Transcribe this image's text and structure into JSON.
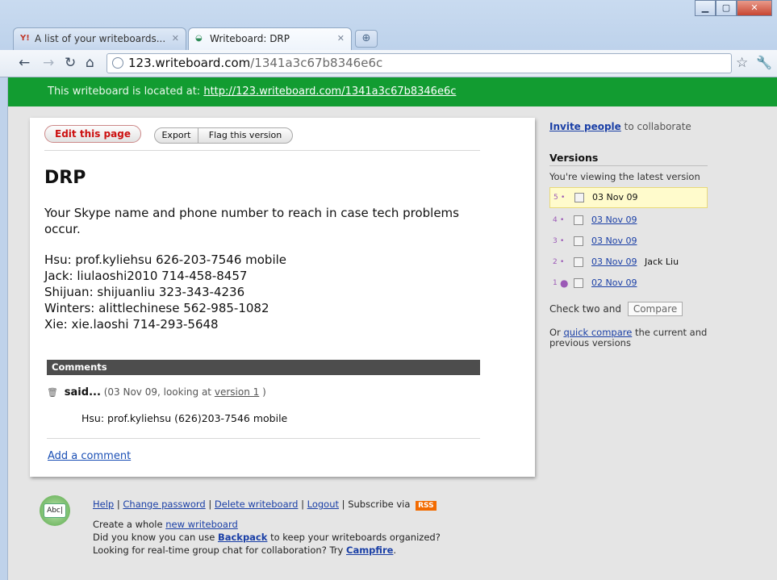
{
  "browser": {
    "tabs": [
      {
        "label": "A list of your writeboards...",
        "icon": "yahoo-icon"
      },
      {
        "label": "Writeboard: DRP",
        "icon": "writeboard-icon"
      }
    ],
    "address": {
      "host": "123.writeboard.com",
      "path": "/1341a3c67b8346e6c"
    }
  },
  "banner": {
    "text": "This writeboard is located at:",
    "link": "http://123.writeboard.com/1341a3c67b8346e6c"
  },
  "toolbar": {
    "edit_label": "Edit this page",
    "export_label": "Export",
    "flag_label": "Flag this version"
  },
  "document": {
    "title": "DRP",
    "intro": "Your Skype name and phone number to reach in case tech problems occur.",
    "contacts": [
      "Hsu: prof.kyliehsu 626-203-7546 mobile",
      "Jack: liulaoshi2010 714-458-8457",
      "Shijuan: shijuanliu 323-343-4236",
      "Winters: alittlechinese 562-985-1082",
      "Xie: xie.laoshi 714-293-5648"
    ]
  },
  "comments": {
    "header": "Comments",
    "said": "said...",
    "meta_prefix": "(03 Nov 09, looking at",
    "version_link": "version 1",
    "meta_suffix": ")",
    "text": "Hsu: prof.kyliehsu (626)203-7546 mobile",
    "add_label": "Add a comment"
  },
  "sidebar": {
    "invite_link": "Invite people",
    "invite_rest": "to collaborate",
    "versions_title": "Versions",
    "viewing_text": "You're viewing the latest version",
    "versions": [
      {
        "num": "5",
        "date": "03 Nov 09",
        "author": "",
        "current": true
      },
      {
        "num": "4",
        "date": "03 Nov 09",
        "author": "",
        "current": false
      },
      {
        "num": "3",
        "date": "03 Nov 09",
        "author": "",
        "current": false
      },
      {
        "num": "2",
        "date": "03 Nov 09",
        "author": "Jack Liu",
        "current": false
      },
      {
        "num": "1",
        "date": "02 Nov 09",
        "author": "",
        "current": false
      }
    ],
    "check_two": "Check two and",
    "compare_label": "Compare",
    "quick_prefix": "Or",
    "quick_link": "quick compare",
    "quick_suffix": "the current and previous versions"
  },
  "footer": {
    "logo_text": "Abc|",
    "help": "Help",
    "change_password": "Change password",
    "delete": "Delete writeboard",
    "logout": "Logout",
    "subscribe": "Subscribe via",
    "rss": "RSS",
    "create_prefix": "Create a whole",
    "create_link": "new writeboard",
    "backpack_prefix": "Did you know you can use",
    "backpack_link": "Backpack",
    "backpack_suffix": "to keep your writeboards organized?",
    "campfire_prefix": "Looking for real-time group chat for collaboration? Try",
    "campfire_link": "Campfire",
    "campfire_suffix": "."
  }
}
